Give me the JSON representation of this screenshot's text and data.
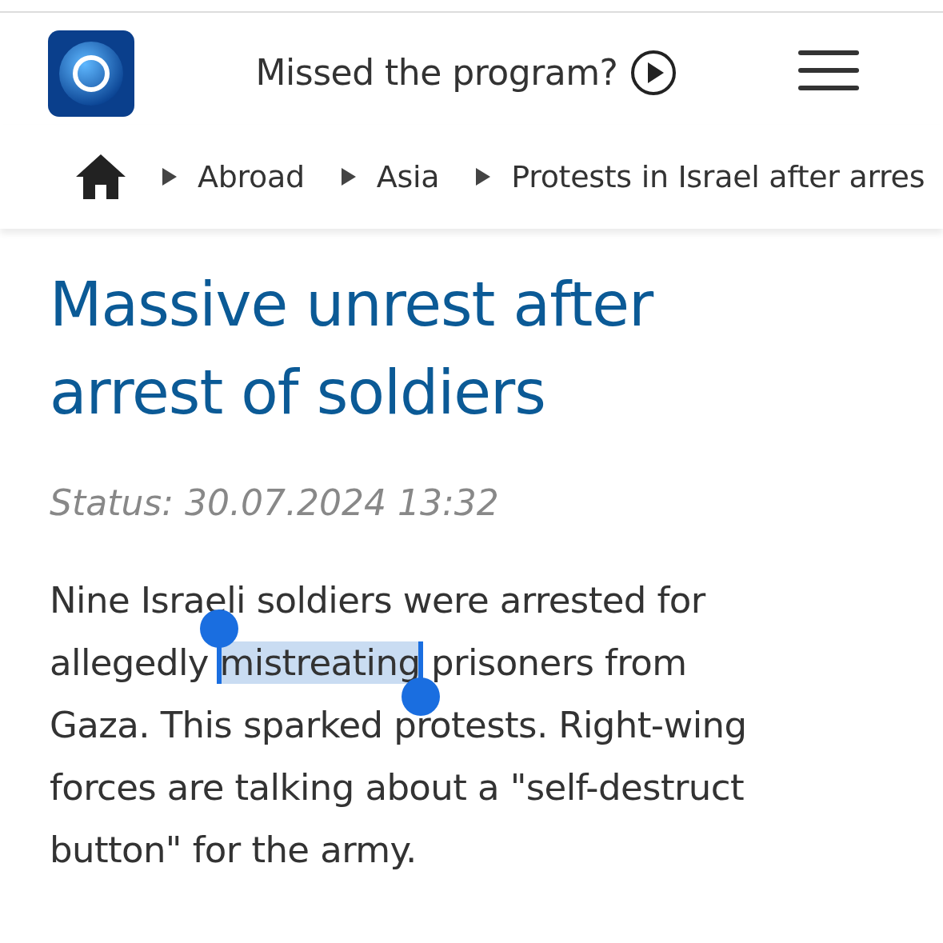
{
  "header": {
    "tagline": "Missed the program?"
  },
  "breadcrumb": [
    {
      "label": "Abroad"
    },
    {
      "label": "Asia"
    },
    {
      "label": "Protests in Israel after arres"
    }
  ],
  "article": {
    "title": "Massive unrest after arrest of soldiers",
    "status": "Status: 30.07.2024 13:32",
    "paragraph": [
      {
        "text": "Nine Israeli soldiers were arrested for allegedly ",
        "selected": false
      },
      {
        "text": "mistreating",
        "selected": true
      },
      {
        "text": " prisoners from Gaza. This sparked protests. Right-wing forces are talking about a \"self-destruct button\" for the army.",
        "selected": false
      }
    ]
  }
}
